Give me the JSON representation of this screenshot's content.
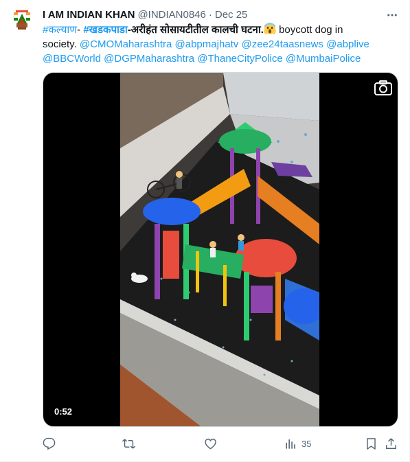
{
  "tweet": {
    "author": {
      "display_name": "I AM INDIAN KHAN",
      "handle": "@INDIAN0846",
      "separator": "·",
      "date": "Dec 25",
      "avatar_icon": "profile-emblem-icon"
    },
    "more_icon": "more-dots-icon",
    "text": {
      "hashtag1": "#कल्याण",
      "dash1": "- ",
      "hashtag2": "#खडकपाडा",
      "body1": "-अरीहंत सोसायटीतील कालची घटना.",
      "emoji": "scream-emoji",
      "body2": " boycott dog in",
      "body3": "society. ",
      "mention1": "@CMOMaharashtra",
      "mention2": "@abpmajhatv",
      "mention3": "@zee24taasnews",
      "mention4": "@abplive",
      "mention5": "@BBCWorld",
      "mention6": "@DGPMaharashtra",
      "mention7": "@ThaneCityPolice",
      "mention8": "@MumbaiPolice"
    },
    "media": {
      "type": "video",
      "duration": "0:52",
      "camera_icon": "camera-icon"
    },
    "actions": {
      "reply_icon": "reply-icon",
      "retweet_icon": "retweet-icon",
      "like_icon": "like-icon",
      "views_icon": "views-icon",
      "views_count": "35",
      "bookmark_icon": "bookmark-icon",
      "share_icon": "share-icon"
    },
    "colors": {
      "link": "#1d9bf0",
      "text": "#0f1419",
      "muted": "#536471"
    }
  }
}
